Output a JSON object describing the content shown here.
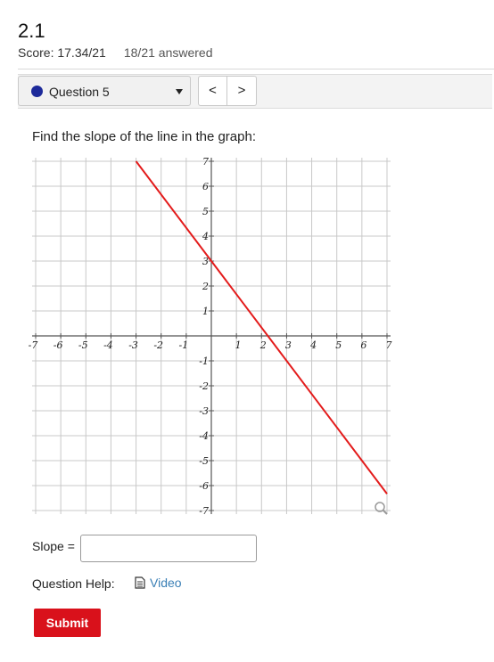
{
  "header": {
    "title": "2.1",
    "score": "Score: 17.34/21",
    "answered": "18/21 answered"
  },
  "question_nav": {
    "selected_question": "Question 5",
    "prev_label": "<",
    "next_label": ">",
    "status_color": "#1d2a9a"
  },
  "question": {
    "prompt": "Find the slope of the line in the graph:"
  },
  "chart_data": {
    "type": "line",
    "xlim": [
      -7,
      7
    ],
    "ylim": [
      -7,
      7
    ],
    "x_ticks": [
      "-7",
      "-6",
      "-5",
      "-4",
      "-3",
      "-2",
      "-1",
      "1",
      "2",
      "3",
      "4",
      "5",
      "6",
      "7"
    ],
    "y_ticks": [
      "7",
      "6",
      "5",
      "4",
      "3",
      "2",
      "1",
      "-1",
      "-2",
      "-3",
      "-4",
      "-5",
      "-6",
      "-7"
    ],
    "grid": true,
    "series": [
      {
        "x": [
          -3,
          7
        ],
        "y": [
          7,
          -6.33
        ],
        "color": "#e31b1b"
      }
    ]
  },
  "answer": {
    "slope_label": "Slope =",
    "slope_value": ""
  },
  "help": {
    "label": "Question Help:",
    "video_label": "Video"
  },
  "actions": {
    "submit_label": "Submit",
    "submit_color": "#d9111b"
  }
}
